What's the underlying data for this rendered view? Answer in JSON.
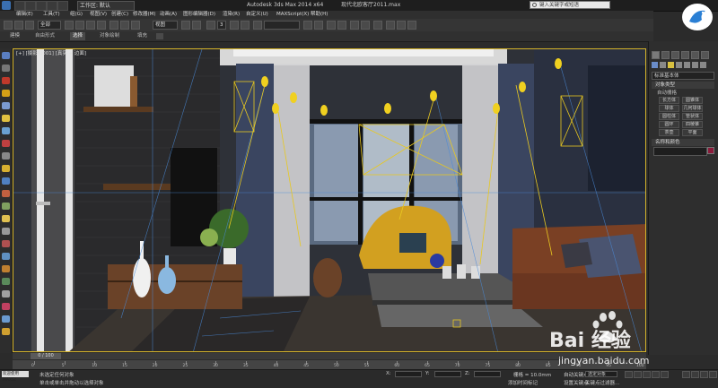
{
  "app": {
    "workspace": "工作区: 默认",
    "title": "Autodesk 3ds Max  2014 x64",
    "file": "现代北欧客厅2011.max",
    "search_placeholder": "键入关键字或短语"
  },
  "menu": [
    "编辑(E)",
    "工具(T)",
    "组(G)",
    "视图(V)",
    "创建(C)",
    "修改器(M)",
    "动画(A)",
    "图形编辑器(D)",
    "渲染(R)",
    "自定义(U)",
    "MAXScript(X)",
    "帮助(H)"
  ],
  "toolbar": {
    "selection_filter": "全部",
    "view_dropdown": "视图",
    "spinner_value": "3"
  },
  "ribbon": {
    "tabs": [
      "建模",
      "自由形式",
      "选择",
      "对象绘制",
      "填充"
    ],
    "active_tab": 2
  },
  "viewport": {
    "label": "[+] [摄影机001] [真实 + 边面]"
  },
  "command_panel": {
    "category": "标准基本体",
    "object_type_header": "对象类型",
    "autogrid": "自动栅格",
    "buttons": [
      "长方体",
      "圆锥体",
      "球体",
      "几何球体",
      "圆柱体",
      "管状体",
      "圆环",
      "四棱锥",
      "茶壶",
      "平面"
    ],
    "name_color_header": "名称和颜色",
    "name_color_swatch": "#8b1a3a"
  },
  "timeline": {
    "slider_text": "0 / 100",
    "ticks": [
      "0",
      "5",
      "10",
      "15",
      "20",
      "25",
      "30",
      "35",
      "40",
      "45",
      "50",
      "55",
      "60",
      "65",
      "70",
      "75",
      "80",
      "85",
      "90",
      "95",
      "100"
    ]
  },
  "status": {
    "selection": "未选定任何对象",
    "hint": "单击或单击并拖动以选择对象",
    "maxscript": "欢迎使用 MAXSc",
    "x_label": "X:",
    "y_label": "Y:",
    "z_label": "Z:",
    "grid": "栅格 = 10.0mm",
    "autokey": "自动关键点",
    "selected_obj": "选定对象",
    "set_key": "设置关键点",
    "key_filter": "关键点过滤器...",
    "add_time_tag": "添加时间标记"
  },
  "watermark": {
    "logo_text": "Bai 经验",
    "url": "jingyan.baidu.com"
  }
}
